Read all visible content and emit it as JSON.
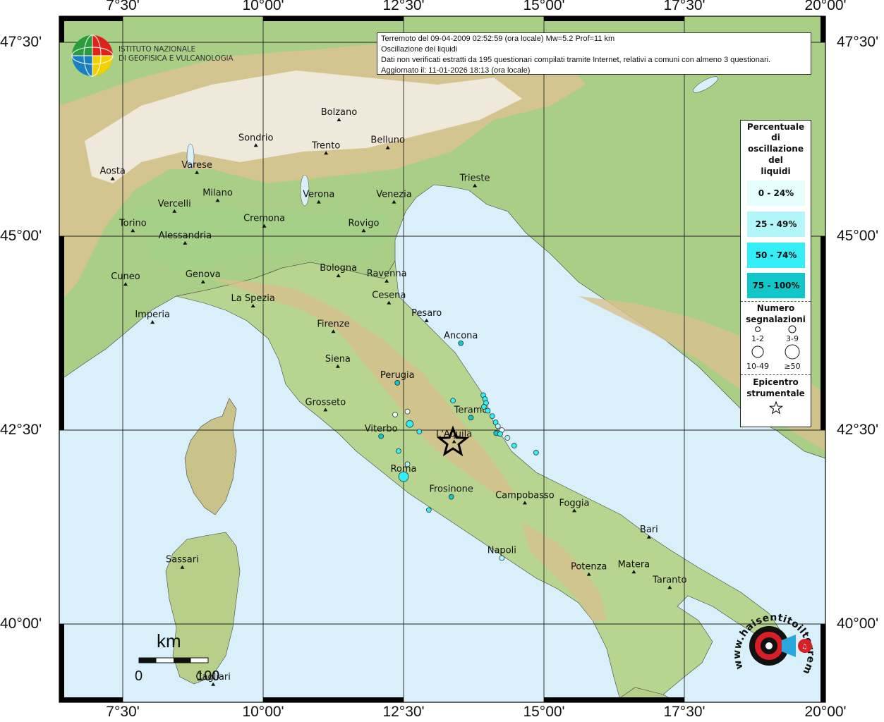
{
  "info": {
    "line1": "Terremoto del 09-04-2009 02:52:59 (ora locale) Mw=5.2 Prof=11 km",
    "line2": "Oscillazione dei liquidi",
    "line3": "Dati non verificati estratti da 195 questionari compilati tramite Internet, relativi a comuni con almeno 3 questionari.",
    "line4": "Aggiornato il: 11-01-2026 18:13 (ora locale)"
  },
  "institute": {
    "line1": "ISTITUTO NAZIONALE",
    "line2": "DI GEOFISICA E VULCANOLOGIA"
  },
  "axes": {
    "longitudes": [
      "7°30'",
      "10°00'",
      "12°30'",
      "15°00'",
      "17°30'",
      "20°00'"
    ],
    "latitudes": [
      "47°30'",
      "45°00'",
      "42°30'",
      "40°00'"
    ]
  },
  "legend": {
    "pct_title": [
      "Percentuale",
      "di",
      "oscillazione",
      "del",
      "liquidi"
    ],
    "classes": [
      {
        "label": "0 - 24%",
        "color": "#e6fdfd"
      },
      {
        "label": "25 - 49%",
        "color": "#b3f6f9"
      },
      {
        "label": "50 - 74%",
        "color": "#33eef6"
      },
      {
        "label": "75 - 100%",
        "color": "#10c6c9"
      }
    ],
    "count_title": [
      "Numero",
      "segnalazioni"
    ],
    "count_labels": [
      "1-2",
      "3-9",
      "10-49",
      "≥50"
    ],
    "epi_title": [
      "Epicentro",
      "strumentale"
    ]
  },
  "scale": {
    "unit": "km",
    "start": "0",
    "end": "100"
  },
  "watermark": {
    "text": "www.haisentitoilterremoto.it"
  },
  "colors": {
    "sea": "#d9f0fb",
    "land_low": "#aed28b",
    "land_mid": "#e0cf96",
    "land_high": "#b99a71",
    "snow": "#f4f2f0"
  },
  "cities": [
    {
      "name": "Bolzano",
      "lon": 11.35,
      "lat": 46.5
    },
    {
      "name": "Sondrio",
      "lon": 9.87,
      "lat": 46.17
    },
    {
      "name": "Trento",
      "lon": 11.12,
      "lat": 46.07
    },
    {
      "name": "Belluno",
      "lon": 12.22,
      "lat": 46.14
    },
    {
      "name": "Varese",
      "lon": 8.82,
      "lat": 45.82
    },
    {
      "name": "Aosta",
      "lon": 7.32,
      "lat": 45.74
    },
    {
      "name": "Milano",
      "lon": 9.19,
      "lat": 45.46
    },
    {
      "name": "Vercelli",
      "lon": 8.42,
      "lat": 45.32
    },
    {
      "name": "Verona",
      "lon": 10.99,
      "lat": 45.44
    },
    {
      "name": "Venezia",
      "lon": 12.33,
      "lat": 45.44
    },
    {
      "name": "Trieste",
      "lon": 13.77,
      "lat": 45.65
    },
    {
      "name": "Torino",
      "lon": 7.68,
      "lat": 45.07
    },
    {
      "name": "Cremona",
      "lon": 10.02,
      "lat": 45.13
    },
    {
      "name": "Rovigo",
      "lon": 11.79,
      "lat": 45.07
    },
    {
      "name": "Alessandria",
      "lon": 8.61,
      "lat": 44.91
    },
    {
      "name": "Bologna",
      "lon": 11.34,
      "lat": 44.49
    },
    {
      "name": "Ravenna",
      "lon": 12.2,
      "lat": 44.42
    },
    {
      "name": "Cuneo",
      "lon": 7.55,
      "lat": 44.38
    },
    {
      "name": "Genova",
      "lon": 8.93,
      "lat": 44.41
    },
    {
      "name": "La Spezia",
      "lon": 9.82,
      "lat": 44.1
    },
    {
      "name": "Cesena",
      "lon": 12.24,
      "lat": 44.14
    },
    {
      "name": "Pesaro",
      "lon": 12.91,
      "lat": 43.91
    },
    {
      "name": "Imperia",
      "lon": 8.03,
      "lat": 43.89
    },
    {
      "name": "Firenze",
      "lon": 11.25,
      "lat": 43.77
    },
    {
      "name": "Ancona",
      "lon": 13.52,
      "lat": 43.62
    },
    {
      "name": "Siena",
      "lon": 11.33,
      "lat": 43.32
    },
    {
      "name": "Perugia",
      "lon": 12.39,
      "lat": 43.11
    },
    {
      "name": "Grosseto",
      "lon": 11.11,
      "lat": 42.76
    },
    {
      "name": "Teramo",
      "lon": 13.7,
      "lat": 42.66
    },
    {
      "name": "Viterbo",
      "lon": 12.1,
      "lat": 42.42
    },
    {
      "name": "L'Aquila",
      "lon": 13.4,
      "lat": 42.35
    },
    {
      "name": "Roma",
      "lon": 12.5,
      "lat": 41.9
    },
    {
      "name": "Frosinone",
      "lon": 13.35,
      "lat": 41.64
    },
    {
      "name": "Campobasso",
      "lon": 14.66,
      "lat": 41.56
    },
    {
      "name": "Foggia",
      "lon": 15.54,
      "lat": 41.46
    },
    {
      "name": "Bari",
      "lon": 16.87,
      "lat": 41.12
    },
    {
      "name": "Napoli",
      "lon": 14.25,
      "lat": 40.85
    },
    {
      "name": "Sassari",
      "lon": 8.56,
      "lat": 40.73
    },
    {
      "name": "Potenza",
      "lon": 15.8,
      "lat": 40.64
    },
    {
      "name": "Matera",
      "lon": 16.6,
      "lat": 40.67
    },
    {
      "name": "Taranto",
      "lon": 17.24,
      "lat": 40.47
    },
    {
      "name": "Cagliari",
      "lon": 9.11,
      "lat": 39.22
    }
  ],
  "epicenter": {
    "lon": 13.38,
    "lat": 42.34
  },
  "observations": [
    {
      "lon": 13.52,
      "lat": 43.62,
      "cls": 3,
      "size": 1
    },
    {
      "lon": 12.39,
      "lat": 43.11,
      "cls": 3,
      "size": 1
    },
    {
      "lon": 13.38,
      "lat": 42.88,
      "cls": 2,
      "size": 1
    },
    {
      "lon": 13.92,
      "lat": 42.95,
      "cls": 2,
      "size": 1
    },
    {
      "lon": 13.95,
      "lat": 42.9,
      "cls": 2,
      "size": 1
    },
    {
      "lon": 13.97,
      "lat": 42.85,
      "cls": 2,
      "size": 1
    },
    {
      "lon": 13.93,
      "lat": 42.8,
      "cls": 2,
      "size": 1
    },
    {
      "lon": 14.0,
      "lat": 42.75,
      "cls": 2,
      "size": 1
    },
    {
      "lon": 14.08,
      "lat": 42.68,
      "cls": 2,
      "size": 1
    },
    {
      "lon": 14.14,
      "lat": 42.6,
      "cls": 2,
      "size": 1
    },
    {
      "lon": 14.18,
      "lat": 42.55,
      "cls": 1,
      "size": 1
    },
    {
      "lon": 14.25,
      "lat": 42.5,
      "cls": 0,
      "size": 1
    },
    {
      "lon": 14.15,
      "lat": 42.46,
      "cls": 3,
      "size": 1
    },
    {
      "lon": 14.22,
      "lat": 42.45,
      "cls": 2,
      "size": 1
    },
    {
      "lon": 14.35,
      "lat": 42.4,
      "cls": 1,
      "size": 1
    },
    {
      "lon": 14.47,
      "lat": 42.3,
      "cls": 2,
      "size": 1
    },
    {
      "lon": 13.7,
      "lat": 42.66,
      "cls": 3,
      "size": 1
    },
    {
      "lon": 12.57,
      "lat": 42.74,
      "cls": 0,
      "size": 1
    },
    {
      "lon": 12.35,
      "lat": 42.7,
      "cls": 0,
      "size": 1
    },
    {
      "lon": 12.61,
      "lat": 42.58,
      "cls": 2,
      "size": 2
    },
    {
      "lon": 12.78,
      "lat": 42.48,
      "cls": 2,
      "size": 1
    },
    {
      "lon": 12.1,
      "lat": 42.42,
      "cls": 3,
      "size": 1
    },
    {
      "lon": 12.41,
      "lat": 42.23,
      "cls": 2,
      "size": 1
    },
    {
      "lon": 12.5,
      "lat": 41.9,
      "cls": 2,
      "size": 3
    },
    {
      "lon": 12.57,
      "lat": 42.06,
      "cls": 1,
      "size": 1
    },
    {
      "lon": 13.35,
      "lat": 41.64,
      "cls": 3,
      "size": 1
    },
    {
      "lon": 12.95,
      "lat": 41.47,
      "cls": 2,
      "size": 1
    },
    {
      "lon": 14.25,
      "lat": 40.85,
      "cls": 1,
      "size": 1
    },
    {
      "lon": 14.86,
      "lat": 42.21,
      "cls": 2,
      "size": 1
    }
  ]
}
